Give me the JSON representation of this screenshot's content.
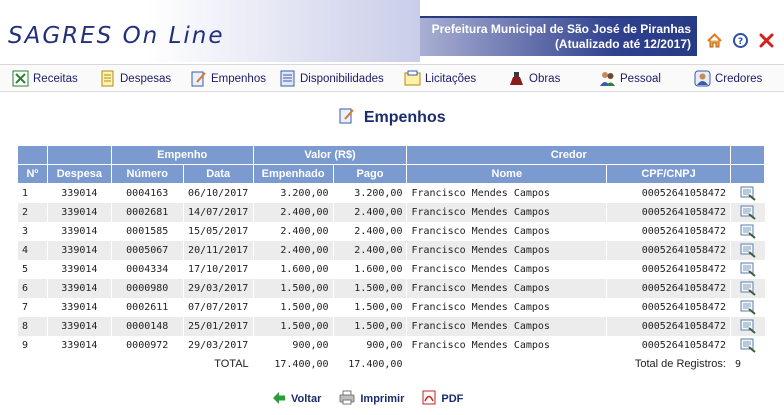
{
  "header": {
    "logo": "SAGRES On Line",
    "prefeitura": "Prefeitura Municipal de São José de Piranhas",
    "atualizado": "(Atualizado até 12/2017)"
  },
  "head_icons": [
    "home-icon",
    "help-icon",
    "close-icon"
  ],
  "menu": [
    {
      "label": "Receitas",
      "icon": "receitas-icon"
    },
    {
      "label": "Despesas",
      "icon": "despesas-icon"
    },
    {
      "label": "Empenhos",
      "icon": "empenhos-icon"
    },
    {
      "label": "Disponibilidades",
      "icon": "disponibilidades-icon"
    },
    {
      "label": "Licitações",
      "icon": "licitacoes-icon"
    },
    {
      "label": "Obras",
      "icon": "obras-icon"
    },
    {
      "label": "Pessoal",
      "icon": "pessoal-icon"
    },
    {
      "label": "Credores",
      "icon": "credores-icon"
    }
  ],
  "title": "Empenhos",
  "table": {
    "group_headers": {
      "empenho": "Empenho",
      "valor": "Valor (R$)",
      "credor": "Credor"
    },
    "columns": [
      "Nº",
      "Despesa",
      "Número",
      "Data",
      "Empenhado",
      "Pago",
      "Nome",
      "CPF/CNPJ"
    ],
    "rows": [
      {
        "n": "1",
        "despesa": "339014",
        "numero": "0004163",
        "data": "06/10/2017",
        "empenhado": "3.200,00",
        "pago": "3.200,00",
        "nome": "Francisco Mendes Campos",
        "cpf": "00052641058472"
      },
      {
        "n": "2",
        "despesa": "339014",
        "numero": "0002681",
        "data": "14/07/2017",
        "empenhado": "2.400,00",
        "pago": "2.400,00",
        "nome": "Francisco Mendes Campos",
        "cpf": "00052641058472"
      },
      {
        "n": "3",
        "despesa": "339014",
        "numero": "0001585",
        "data": "15/05/2017",
        "empenhado": "2.400,00",
        "pago": "2.400,00",
        "nome": "Francisco Mendes Campos",
        "cpf": "00052641058472"
      },
      {
        "n": "4",
        "despesa": "339014",
        "numero": "0005067",
        "data": "20/11/2017",
        "empenhado": "2.400,00",
        "pago": "2.400,00",
        "nome": "Francisco Mendes Campos",
        "cpf": "00052641058472"
      },
      {
        "n": "5",
        "despesa": "339014",
        "numero": "0004334",
        "data": "17/10/2017",
        "empenhado": "1.600,00",
        "pago": "1.600,00",
        "nome": "Francisco Mendes Campos",
        "cpf": "00052641058472"
      },
      {
        "n": "6",
        "despesa": "339014",
        "numero": "0000980",
        "data": "29/03/2017",
        "empenhado": "1.500,00",
        "pago": "1.500,00",
        "nome": "Francisco Mendes Campos",
        "cpf": "00052641058472"
      },
      {
        "n": "7",
        "despesa": "339014",
        "numero": "0002611",
        "data": "07/07/2017",
        "empenhado": "1.500,00",
        "pago": "1.500,00",
        "nome": "Francisco Mendes Campos",
        "cpf": "00052641058472"
      },
      {
        "n": "8",
        "despesa": "339014",
        "numero": "0000148",
        "data": "25/01/2017",
        "empenhado": "1.500,00",
        "pago": "1.500,00",
        "nome": "Francisco Mendes Campos",
        "cpf": "00052641058472"
      },
      {
        "n": "9",
        "despesa": "339014",
        "numero": "0000972",
        "data": "29/03/2017",
        "empenhado": "900,00",
        "pago": "900,00",
        "nome": "Francisco Mendes Campos",
        "cpf": "00052641058472"
      }
    ],
    "total_label": "TOTAL",
    "total_empenhado": "17.400,00",
    "total_pago": "17.400,00",
    "registros_label": "Total de Registros:",
    "registros_count": "9"
  },
  "actions": {
    "voltar": "Voltar",
    "imprimir": "Imprimir",
    "pdf": "PDF"
  },
  "colors": {
    "header_blue": "#30428f",
    "table_header": "#7b9bd0",
    "row_alt": "#ececec"
  }
}
